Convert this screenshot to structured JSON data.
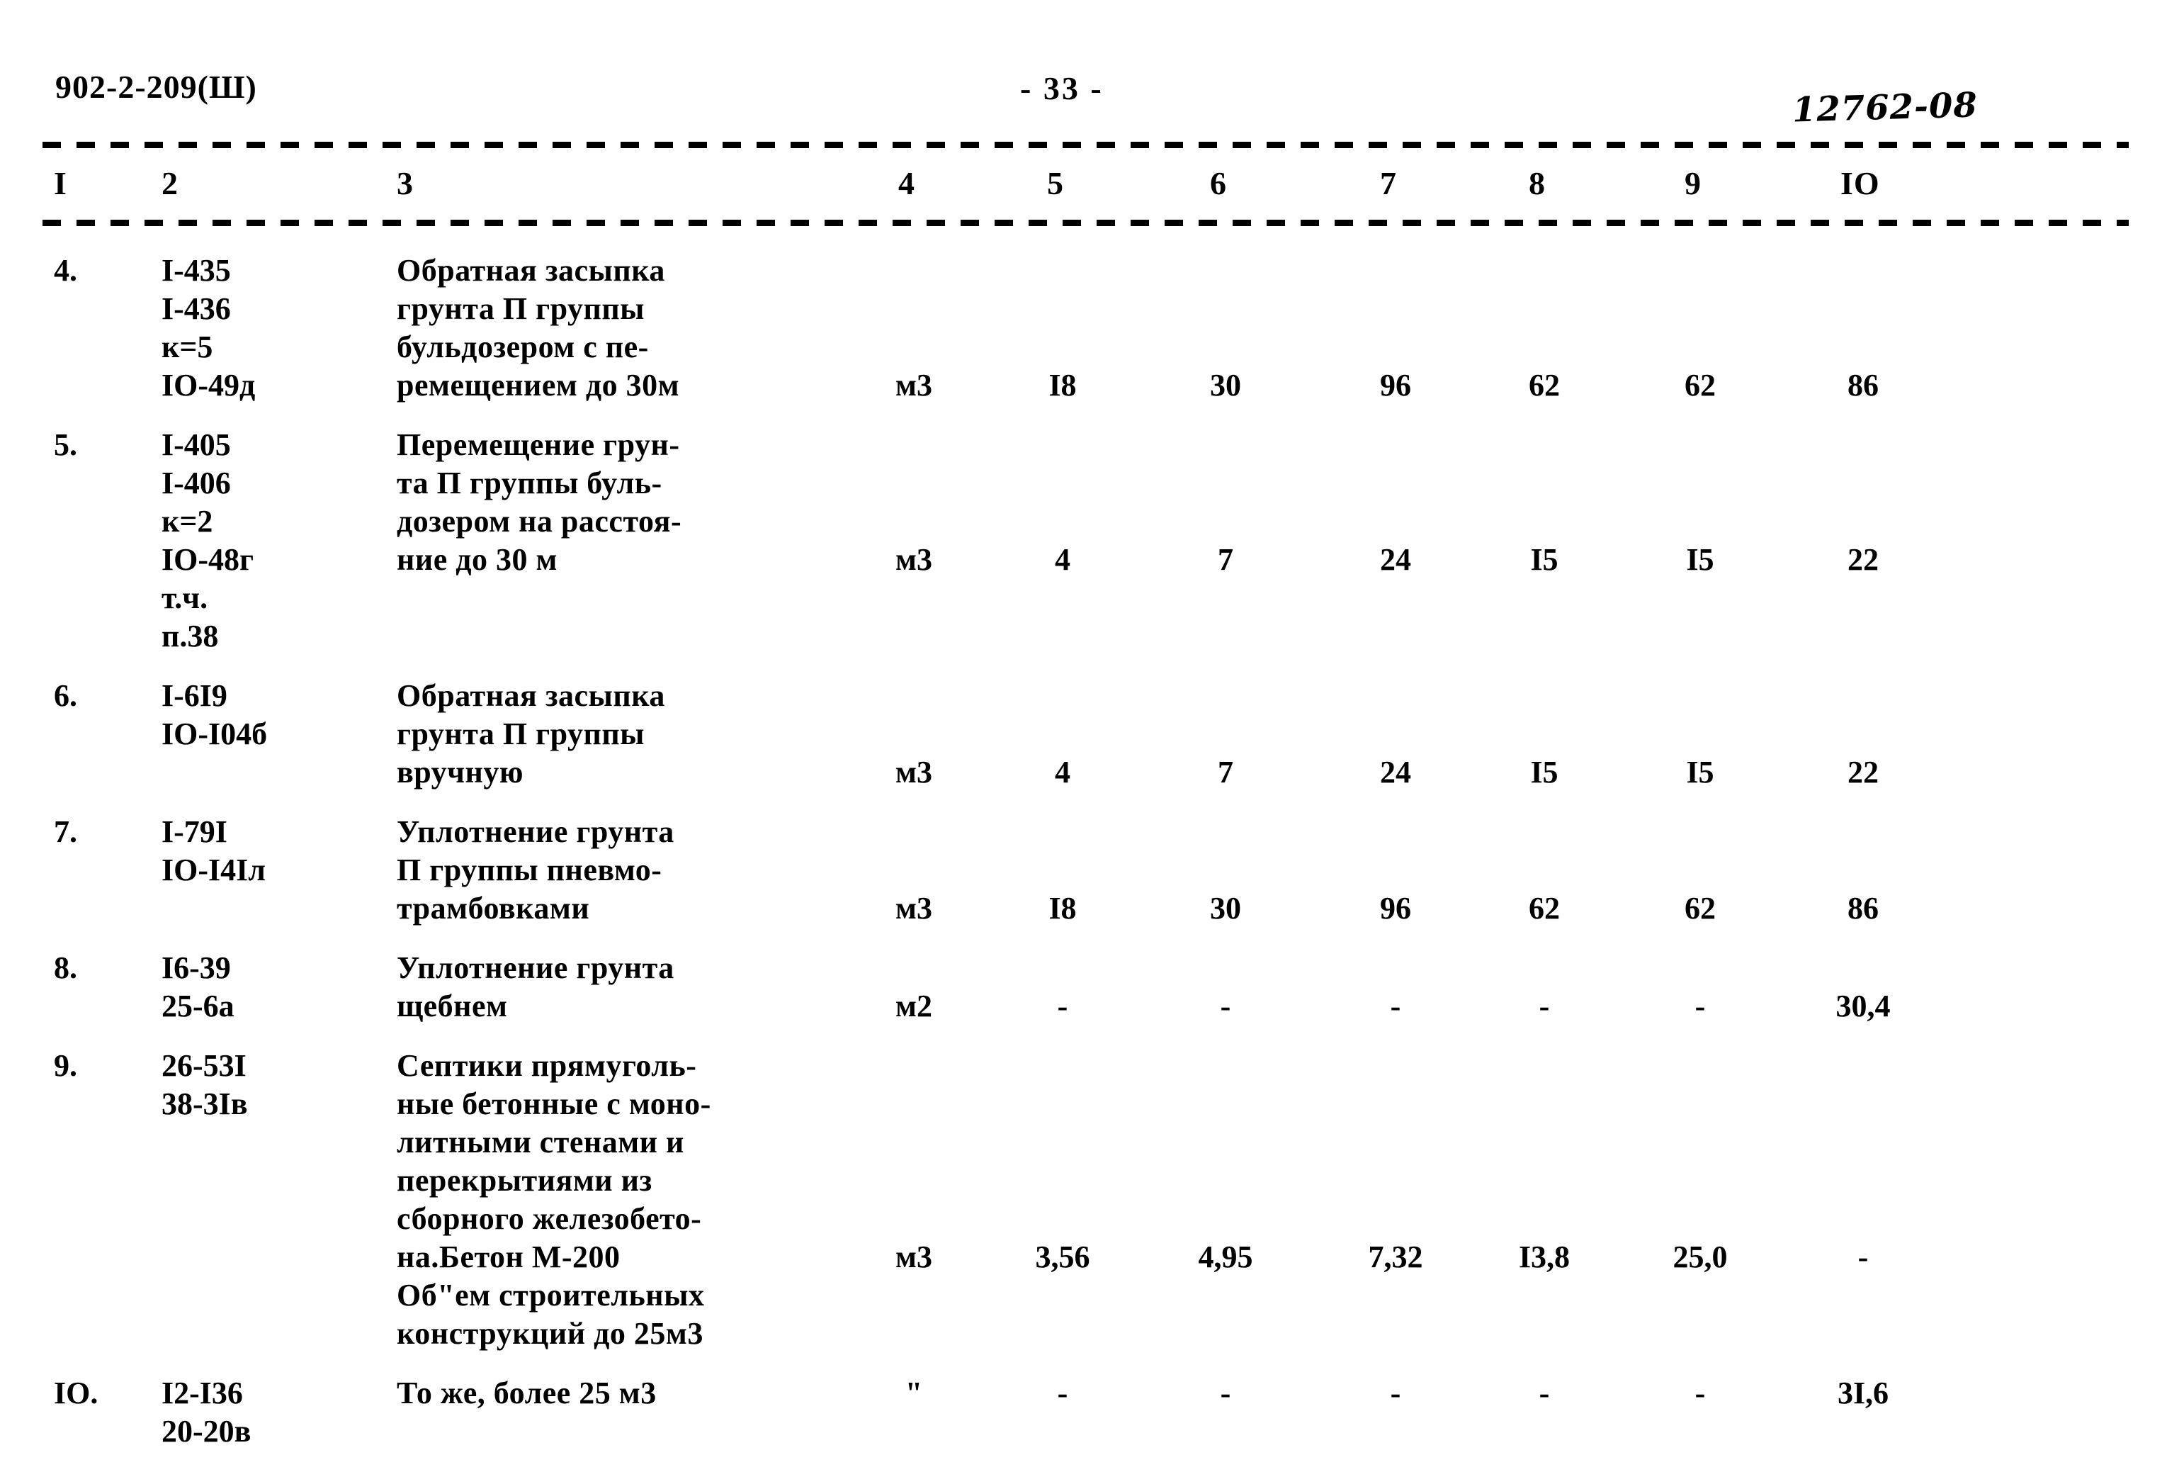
{
  "header": {
    "doc_code": "902-2-209(Ш)",
    "page_number": "- 33 -",
    "stamp": "12762-08"
  },
  "table": {
    "column_headers": [
      "I",
      "2",
      "3",
      "4",
      "5",
      "6",
      "7",
      "8",
      "9",
      "IO"
    ],
    "rows": [
      {
        "num": "4.",
        "codes": "I-435\nI-436\nк=5\nIO-49д",
        "desc": "Обратная засыпка\nгрунта П группы\nбульдозером с пе-\nремещением до 30м",
        "values": [
          "м3",
          "I8",
          "30",
          "96",
          "62",
          "62",
          "86"
        ],
        "values_offset_lines": 3
      },
      {
        "num": "5.",
        "codes": "I-405\nI-406\nк=2\nIO-48г\nт.ч.\nп.38",
        "desc": "Перемещение грун-\nта П группы буль-\nдозером на расстоя-\nние до 30 м",
        "values": [
          "м3",
          "4",
          "7",
          "24",
          "I5",
          "I5",
          "22"
        ],
        "values_offset_lines": 3
      },
      {
        "num": "6.",
        "codes": "I-6I9\nIO-I04б",
        "desc": "Обратная засыпка\nгрунта П группы\nвручную",
        "values": [
          "м3",
          "4",
          "7",
          "24",
          "I5",
          "I5",
          "22"
        ],
        "values_offset_lines": 2
      },
      {
        "num": "7.",
        "codes": "I-79I\nIO-I4Iл",
        "desc": "Уплотнение грунта\nП группы пневмо-\nтрамбовками",
        "values": [
          "м3",
          "I8",
          "30",
          "96",
          "62",
          "62",
          "86"
        ],
        "values_offset_lines": 2
      },
      {
        "num": "8.",
        "codes": "I6-39\n25-6а",
        "desc": "Уплотнение грунта\nщебнем",
        "values": [
          "м2",
          "-",
          "-",
          "-",
          "-",
          "-",
          "30,4"
        ],
        "values_offset_lines": 1
      },
      {
        "num": "9.",
        "codes": "26-53I\n38-3Iв",
        "desc": "Септики прямуголь-\nные бетонные с моно-\nлитными стенами и\nперекрытиями из\nсборного железобето-\nна.Бетон М-200\nОб\"ем строительных\nконструкций до 25м3",
        "values": [
          "м3",
          "3,56",
          "4,95",
          "7,32",
          "I3,8",
          "25,0",
          "-"
        ],
        "values_offset_lines": 5
      },
      {
        "num": "IO.",
        "codes": "I2-I36\n20-20в",
        "desc": "То же, более 25 м3",
        "values": [
          "\"",
          "-",
          "-",
          "-",
          "-",
          "-",
          "3I,6"
        ],
        "values_offset_lines": 0
      }
    ]
  }
}
